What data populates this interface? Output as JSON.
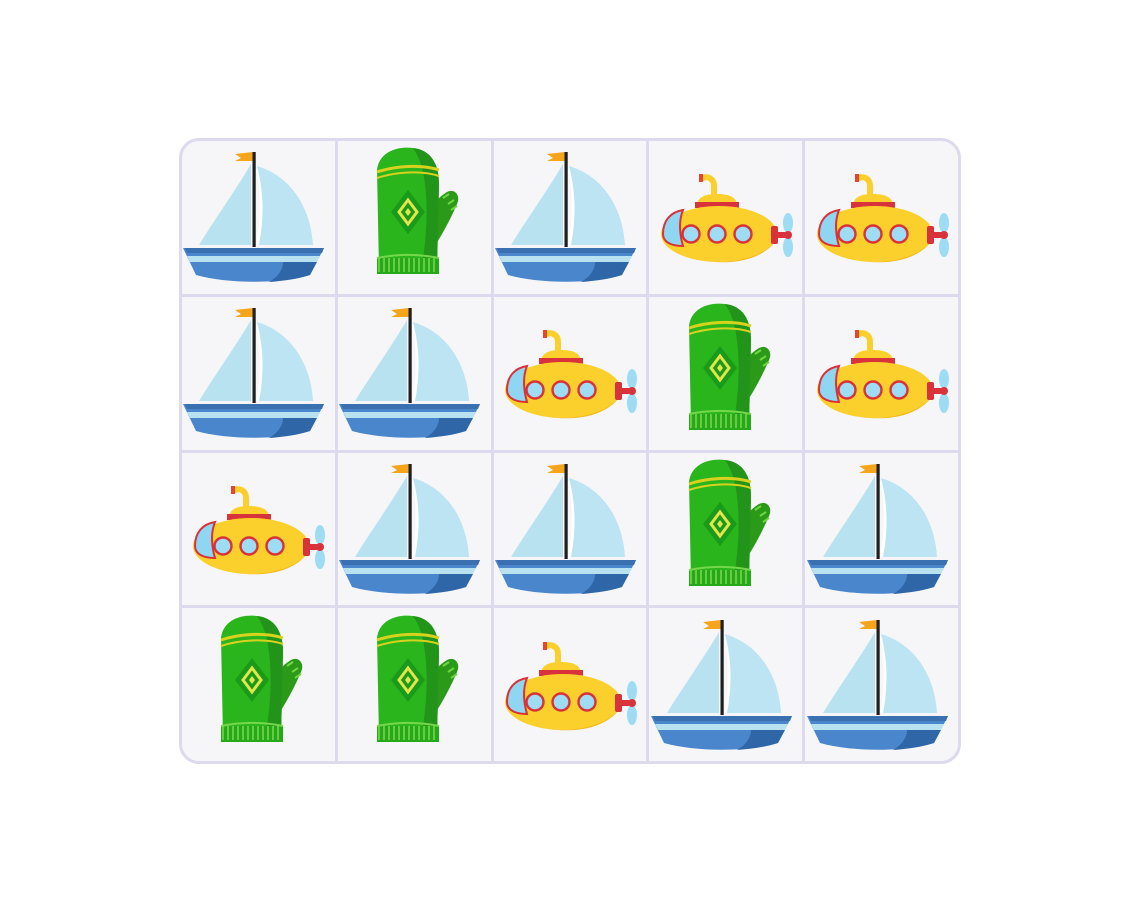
{
  "board": {
    "columns": 5,
    "rows": 4,
    "tiles": [
      {
        "icon": "sailboat-icon"
      },
      {
        "icon": "mitten-icon"
      },
      {
        "icon": "sailboat-icon"
      },
      {
        "icon": "submarine-icon"
      },
      {
        "icon": "submarine-icon"
      },
      {
        "icon": "sailboat-icon"
      },
      {
        "icon": "sailboat-icon"
      },
      {
        "icon": "submarine-icon"
      },
      {
        "icon": "mitten-icon"
      },
      {
        "icon": "submarine-icon"
      },
      {
        "icon": "submarine-icon"
      },
      {
        "icon": "sailboat-icon"
      },
      {
        "icon": "sailboat-icon"
      },
      {
        "icon": "mitten-icon"
      },
      {
        "icon": "sailboat-icon"
      },
      {
        "icon": "mitten-icon"
      },
      {
        "icon": "mitten-icon"
      },
      {
        "icon": "submarine-icon"
      },
      {
        "icon": "sailboat-icon"
      },
      {
        "icon": "sailboat-icon"
      }
    ]
  },
  "colors": {
    "tile_background": "#f6f6f9",
    "grid_lines": "#dcdaec",
    "sail": "#b9e2f1",
    "hull": "#4a86cc",
    "mitten": "#2bb51d",
    "submarine": "#fcd02c"
  }
}
